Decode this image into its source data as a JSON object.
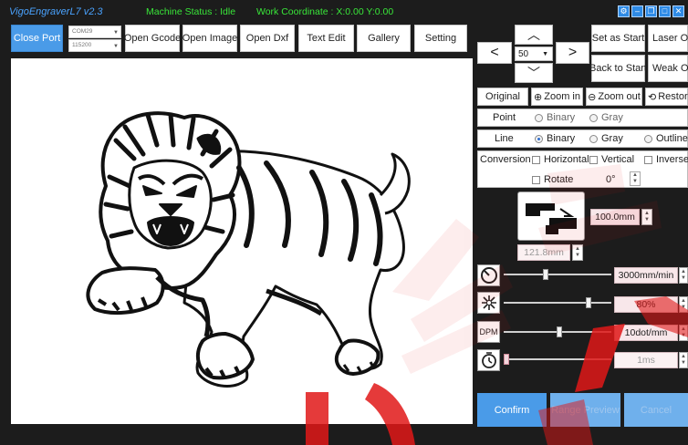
{
  "titlebar": {
    "app_title": "VigoEngraverL7 v2.3",
    "machine_status": "Machine Status : Idle",
    "work_coordinate": "Work Coordinate : X:0.00 Y:0.00"
  },
  "toolbar": {
    "close_port": "Close Port",
    "port": "COM29",
    "baud": "115200",
    "open_gcode": "Open Gcode",
    "open_image": "Open Image",
    "open_dxf": "Open Dxf",
    "text_edit": "Text Edit",
    "gallery": "Gallery",
    "setting": "Setting"
  },
  "jog": {
    "step": "50",
    "set_as_start": "Set as Start",
    "back_to_start": "Back to Start",
    "laser_on": "Laser On",
    "weak_on": "Weak On"
  },
  "view": {
    "original": "Original",
    "zoom_in": "Zoom in",
    "zoom_out": "Zoom out",
    "restore": "Restore"
  },
  "point_mode": {
    "label": "Point",
    "binary": "Binary",
    "gray": "Gray"
  },
  "line_mode": {
    "label": "Line",
    "binary": "Binary",
    "gray": "Gray",
    "outline": "Outline"
  },
  "conversion": {
    "label": "Conversion",
    "horizontal": "Horizontal",
    "vertical": "Vertical",
    "inverse": "Inverse",
    "rotate": "Rotate",
    "rotate_angle": "0°"
  },
  "size": {
    "width": "100.0mm",
    "height": "121.8mm"
  },
  "params": {
    "speed": "3000mm/min",
    "power": "80%",
    "dpm_label": "DPM",
    "dpm": "10dot/mm",
    "delay": "1ms",
    "speed_level": 0.38,
    "power_level": 0.8,
    "dpm_level": 0.52,
    "delay_level": 0.0
  },
  "actions": {
    "confirm": "Confirm",
    "range_preview": "Range Preview",
    "cancel": "Cancel"
  },
  "colors": {
    "accent": "#4a9be8",
    "status_green": "#39e639",
    "title_blue": "#4aa3ff",
    "value_pink": "#f8e7ea"
  }
}
